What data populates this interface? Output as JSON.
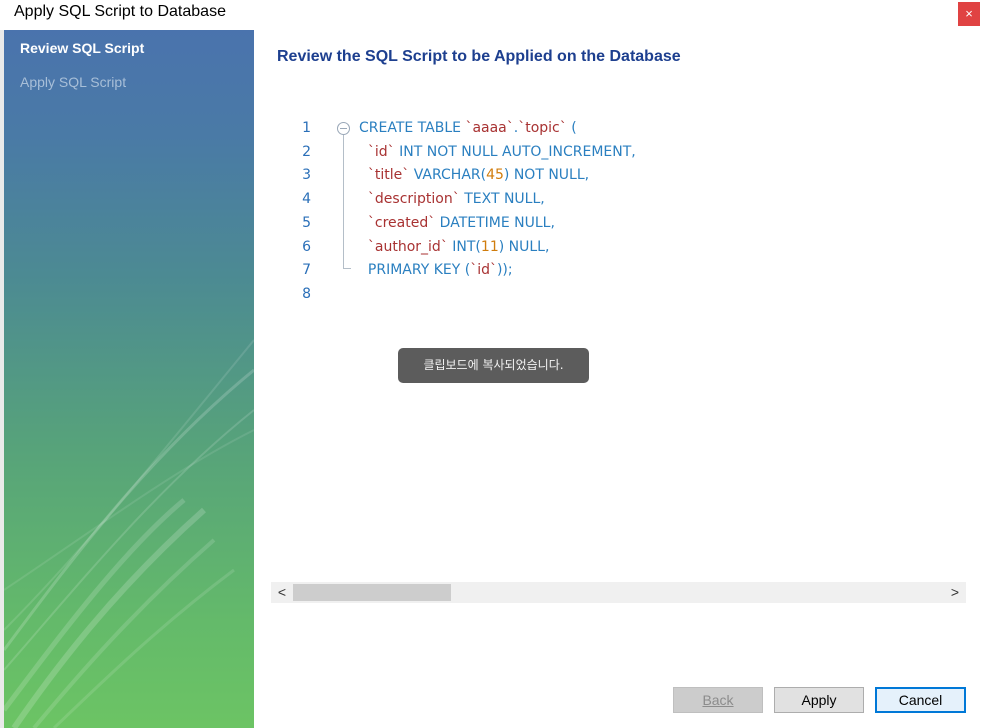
{
  "window": {
    "title": "Apply SQL Script to Database",
    "close_glyph": "×"
  },
  "sidebar": {
    "items": [
      {
        "label": "Review SQL Script",
        "active": true
      },
      {
        "label": "Apply SQL Script",
        "active": false
      }
    ]
  },
  "main": {
    "heading": "Review the SQL Script to be Applied on the Database"
  },
  "editor": {
    "line_numbers": [
      "1",
      "2",
      "3",
      "4",
      "5",
      "6",
      "7",
      "8"
    ],
    "lines": [
      {
        "segments": [
          {
            "t": "CREATE TABLE ",
            "c": "kw"
          },
          {
            "t": "`aaaa`",
            "c": "id"
          },
          {
            "t": ".",
            "c": "kw"
          },
          {
            "t": "`topic`",
            "c": "id"
          },
          {
            "t": " (",
            "c": "kw"
          }
        ]
      },
      {
        "segments": [
          {
            "t": "  ",
            "c": "kw"
          },
          {
            "t": "`id`",
            "c": "id"
          },
          {
            "t": " INT NOT NULL AUTO_INCREMENT,",
            "c": "kw"
          }
        ]
      },
      {
        "segments": [
          {
            "t": "  ",
            "c": "kw"
          },
          {
            "t": "`title`",
            "c": "id"
          },
          {
            "t": " VARCHAR(",
            "c": "kw"
          },
          {
            "t": "45",
            "c": "num"
          },
          {
            "t": ") NOT NULL,",
            "c": "kw"
          }
        ]
      },
      {
        "segments": [
          {
            "t": "  ",
            "c": "kw"
          },
          {
            "t": "`description`",
            "c": "id"
          },
          {
            "t": " TEXT NULL,",
            "c": "kw"
          }
        ]
      },
      {
        "segments": [
          {
            "t": "  ",
            "c": "kw"
          },
          {
            "t": "`created`",
            "c": "id"
          },
          {
            "t": " DATETIME NULL,",
            "c": "kw"
          }
        ]
      },
      {
        "segments": [
          {
            "t": "  ",
            "c": "kw"
          },
          {
            "t": "`author_id`",
            "c": "id"
          },
          {
            "t": " INT(",
            "c": "kw"
          },
          {
            "t": "11",
            "c": "num"
          },
          {
            "t": ") NULL,",
            "c": "kw"
          }
        ]
      },
      {
        "segments": [
          {
            "t": "  PRIMARY KEY (",
            "c": "kw"
          },
          {
            "t": "`id`",
            "c": "id"
          },
          {
            "t": "));",
            "c": "kw"
          }
        ]
      },
      {
        "segments": []
      }
    ],
    "colors": {
      "keyword": "#2a7fc0",
      "identifier": "#a83232",
      "number": "#d07c0c",
      "line_number": "#2a6fb8"
    }
  },
  "toast": {
    "text": "클립보드에 복사되었습니다."
  },
  "scrollbar": {
    "left_glyph": "<",
    "right_glyph": ">"
  },
  "buttons": {
    "back": "Back",
    "apply": "Apply",
    "cancel": "Cancel"
  }
}
